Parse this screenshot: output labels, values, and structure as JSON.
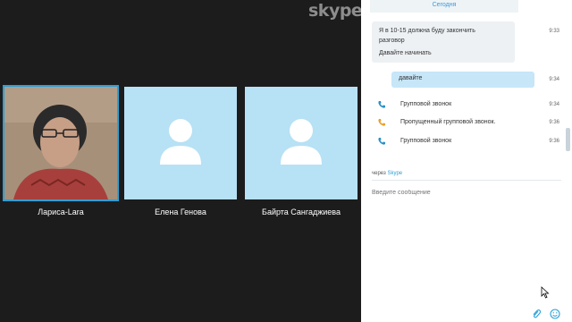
{
  "brand": {
    "logo_text": "skype"
  },
  "participants": [
    {
      "name": "Лариса-Lara",
      "active": true
    },
    {
      "name": "Елена Генова",
      "active": false
    },
    {
      "name": "Байрта Сангаджиева",
      "active": false
    }
  ],
  "chat": {
    "date_label": "Сегодня",
    "messages": [
      {
        "line1": "Я в 10-15 должна буду закончить",
        "line2": "разговор",
        "line3": "Давайте начинать",
        "time": "9:33"
      },
      {
        "text": "давайте",
        "time": "9:34"
      }
    ],
    "call_events": [
      {
        "label": "Групповой звонок",
        "time": "9:34",
        "color": "#2a8fc6"
      },
      {
        "label": "Пропущенный групповой звонок.",
        "time": "9:36",
        "color": "#e7a02a"
      },
      {
        "label": "Групповой звонок",
        "time": "9:36",
        "color": "#2a8fc6"
      }
    ],
    "via_prefix": "через",
    "via_brand": "Skype",
    "input_placeholder": "Введите сообщение"
  },
  "icons": [
    "phone-icon",
    "attach-icon",
    "emoji-icon",
    "cursor-icon"
  ],
  "colors": {
    "accent": "#2ca0d8",
    "tile_bg": "#b7e1f5",
    "outgoing_bubble": "#c7e6f8"
  }
}
